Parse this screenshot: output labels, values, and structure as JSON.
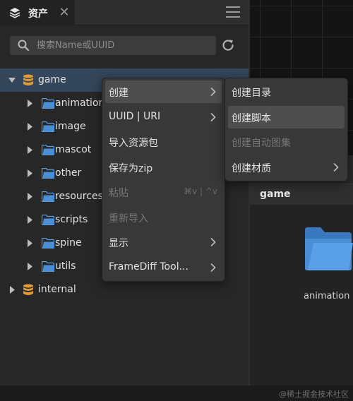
{
  "assets_panel": {
    "tab_title": "资产",
    "search_placeholder": "搜索Name或UUID",
    "tree": [
      {
        "label": "game",
        "type": "db",
        "expanded": true,
        "selected": true
      },
      {
        "label": "animation",
        "type": "folder"
      },
      {
        "label": "image",
        "type": "folder"
      },
      {
        "label": "mascot",
        "type": "folder"
      },
      {
        "label": "other",
        "type": "folder"
      },
      {
        "label": "resources",
        "type": "folder"
      },
      {
        "label": "scripts",
        "type": "folder"
      },
      {
        "label": "spine",
        "type": "folder"
      },
      {
        "label": "utils",
        "type": "folder"
      },
      {
        "label": "internal",
        "type": "db",
        "expanded": false
      }
    ]
  },
  "context_menu": {
    "items": [
      {
        "label": "创建",
        "submenu": true,
        "highlighted": true
      },
      {
        "label": "UUID | URI",
        "submenu": true
      },
      {
        "label": "导入资源包"
      },
      {
        "label": "保存为zip"
      },
      {
        "label": "粘贴",
        "disabled": true,
        "shortcut": "⌘v | ^v"
      },
      {
        "label": "重新导入",
        "disabled": true
      },
      {
        "label": "显示",
        "submenu": true
      },
      {
        "label": "FrameDiff Tool...",
        "submenu": true
      }
    ]
  },
  "submenu": {
    "items": [
      {
        "label": "创建目录"
      },
      {
        "label": "创建脚本",
        "highlighted": true
      },
      {
        "label": "创建自动图集",
        "disabled": true
      },
      {
        "label": "创建材质",
        "submenu": true
      }
    ]
  },
  "preview": {
    "title": "game",
    "folder_label": "animation"
  },
  "watermark": "@稀土掘金技术社区",
  "colors": {
    "folder": "#4a8fd6",
    "db": "#e09a3a",
    "selection": "#34465a",
    "menu_bg": "#383838",
    "menu_highlight": "#4e4e4e"
  }
}
